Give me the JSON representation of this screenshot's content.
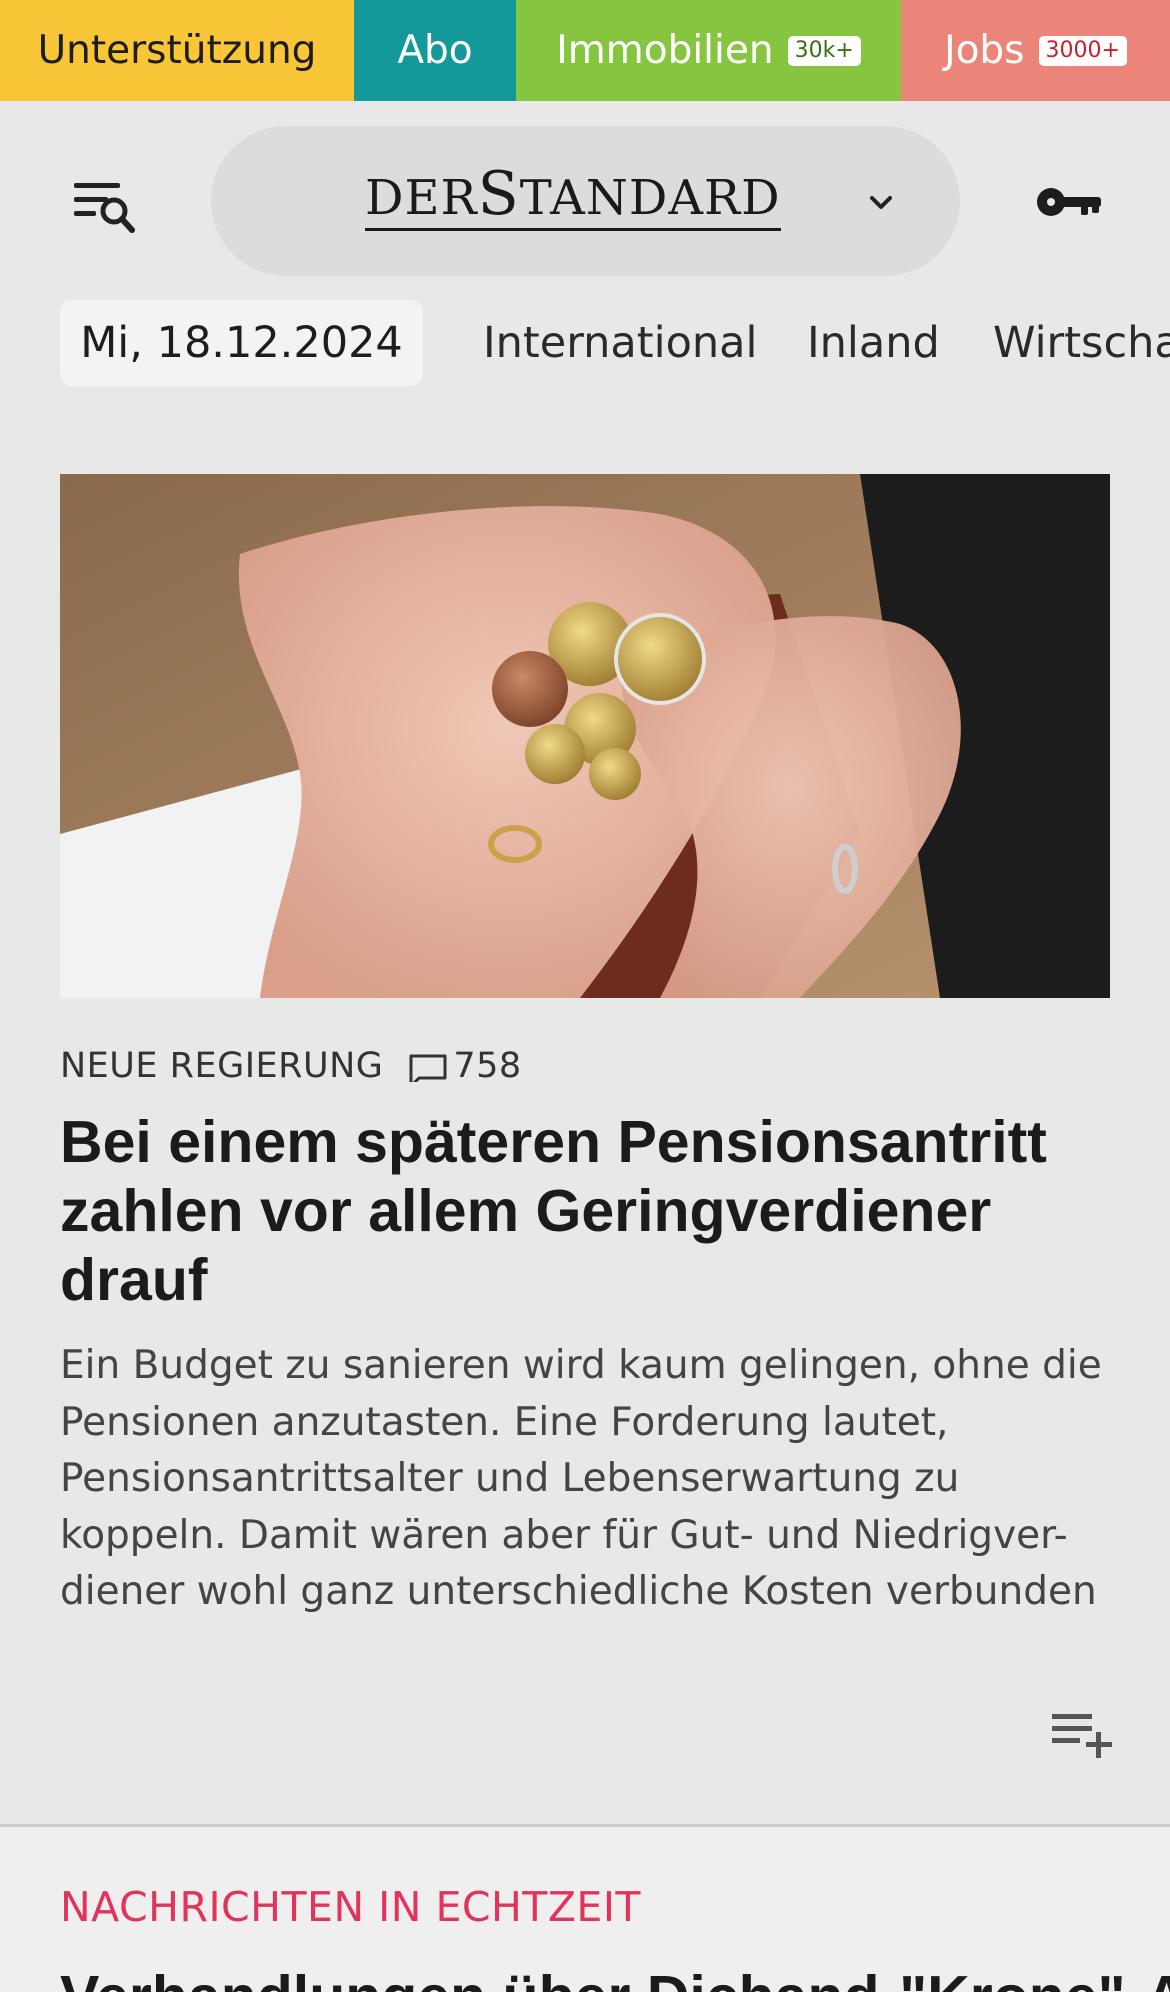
{
  "top_tabs": [
    {
      "label": "Unterstützung",
      "color": "#f8c636"
    },
    {
      "label": "Abo",
      "color": "#14999b"
    },
    {
      "label": "Immobilien",
      "badge": "30k+",
      "color": "#85c540"
    },
    {
      "label": "Jobs",
      "badge": "3000+",
      "color": "#ec8579"
    }
  ],
  "header": {
    "logo_text_1": "DER",
    "logo_text_2": "S",
    "logo_text_3": "TANDARD",
    "menu_icon": "menu-search-icon",
    "dropdown_icon": "chevron-down-icon",
    "login_icon": "key-icon"
  },
  "nav": {
    "date": "Mi, 18.12.2024",
    "items": [
      "International",
      "Inland",
      "Wirtschaft"
    ]
  },
  "article": {
    "image_alt": "Hände halten Euro-Münzen",
    "kicker": "NEUE REGIERUNG",
    "comment_icon": "comment-icon",
    "comment_count": "758",
    "headline": "Bei einem späteren Pensionsantritt zahlen vor allem Geringverdiener drauf",
    "teaser": "Ein Budget zu sanieren wird kaum gelingen, ohne die Pensionen anzutasten. Eine Forderung lautet, Pensionsantrittsalter und Lebenserwartung zu koppeln. Damit wären aber für Gut- und Niedrigver-diener wohl ganz unterschiedliche Kosten verbunden",
    "playlist_icon": "playlist-add-icon"
  },
  "live": {
    "label": "NACHRICHTEN IN ECHTZEIT",
    "next_headline": "Verhandlungen über Dichand-\"Krone\"-Anteile"
  },
  "colors": {
    "background": "#e8e8e8",
    "accent_red": "#e2335a"
  }
}
